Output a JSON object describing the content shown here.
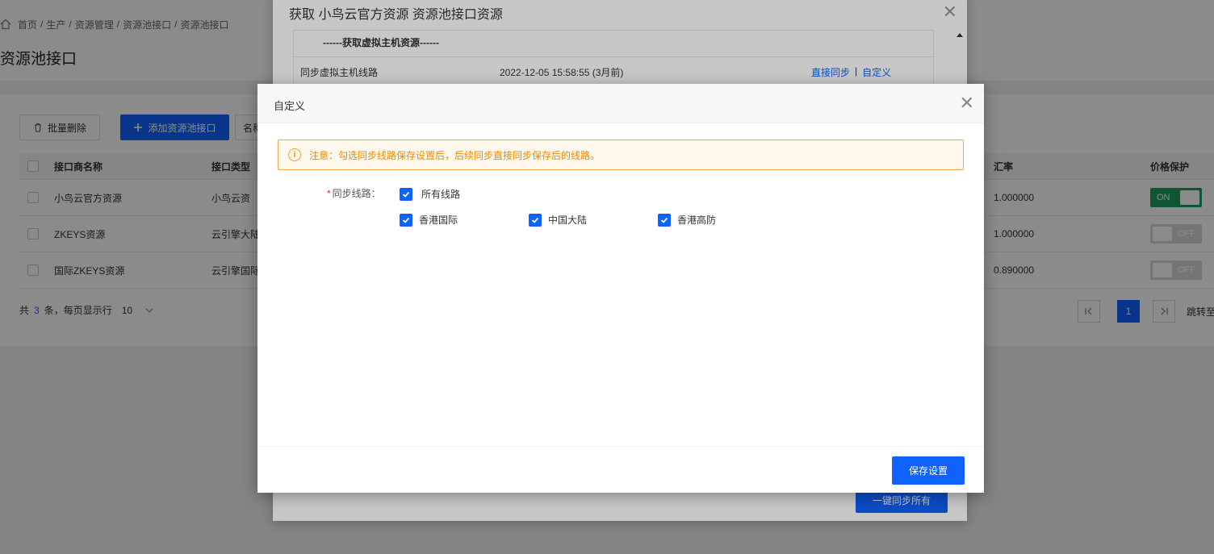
{
  "breadcrumb": [
    "首页",
    "生产",
    "资源管理",
    "资源池接口",
    "资源池接口"
  ],
  "page_title": "资源池接口",
  "toolbar": {
    "batch_delete": "批量删除",
    "add_interface": "添加资源池接口",
    "name_partial": "名称"
  },
  "table": {
    "headers": {
      "name": "接口商名称",
      "type": "接口类型",
      "rate": "汇率",
      "price_protect": "价格保护"
    },
    "rows": [
      {
        "name": "小鸟云官方资源",
        "type": "小鸟云资",
        "rate": "1.000000",
        "toggle": "ON",
        "on": true
      },
      {
        "name": "ZKEYS资源",
        "type": "云引擎大陆",
        "rate": "1.000000",
        "toggle": "OFF",
        "on": false
      },
      {
        "name": "国际ZKEYS资源",
        "type": "云引擎国际",
        "rate": "0.890000",
        "toggle": "OFF",
        "on": false
      }
    ]
  },
  "footer": {
    "prefix": "共",
    "total": "3",
    "suffix": "条，每页显示行",
    "page_size": "10",
    "current_page": "1",
    "jump": "跳转至"
  },
  "outer_dialog": {
    "title": "获取 小鸟云官方资源 资源池接口资源",
    "section": "------获取虚拟主机资源------",
    "row_name": "同步虚拟主机线路",
    "row_time": "2022-12-05 15:58:55 (3月前)",
    "link_sync": "直接同步",
    "link_sep": "|",
    "link_custom": "自定义",
    "sync_all": "一键同步所有"
  },
  "inner_dialog": {
    "title": "自定义",
    "notice": "注意：勾选同步线路保存设置后，后续同步直接同步保存后的线路。",
    "field_required": "*",
    "field_label": "同步线路：",
    "all_lines": "所有线路",
    "lines": [
      "香港国际",
      "中国大陆",
      "香港高防"
    ],
    "save": "保存设置"
  },
  "colors": {
    "primary": "#1062ff",
    "warning": "#f08a00",
    "toggle_on": "#19a05b",
    "required": "#f5222d"
  },
  "icons": {
    "home": "home-icon",
    "trash": "trash-icon",
    "plus": "plus-icon",
    "close": "close-icon",
    "info": "info-icon",
    "check": "check-icon",
    "chevron_down": "chevron-down-icon",
    "first_page": "first-page-icon",
    "last_page": "last-page-icon"
  }
}
